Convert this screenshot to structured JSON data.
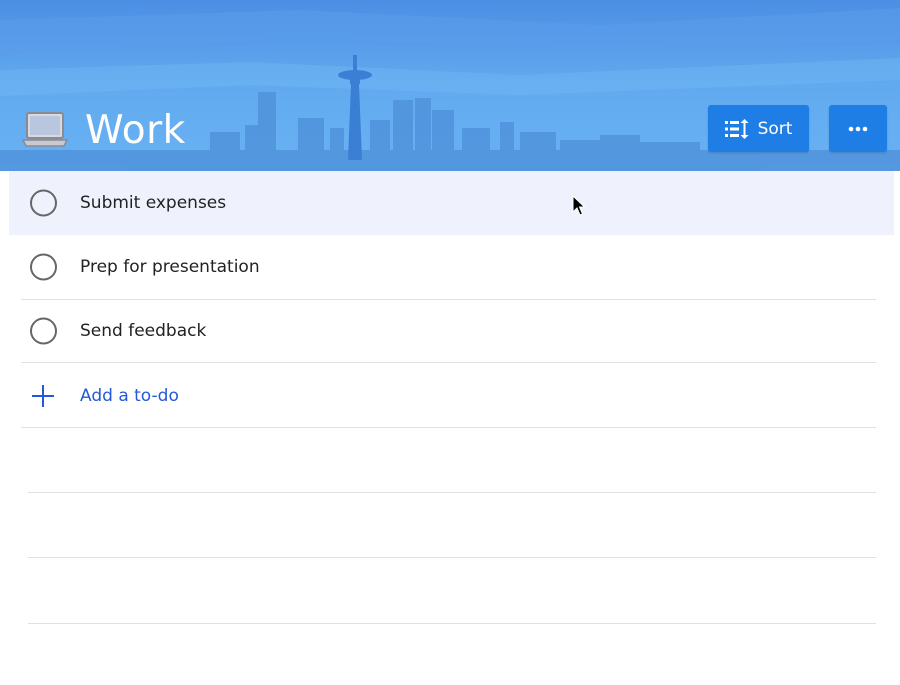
{
  "list": {
    "title": "Work",
    "icon": "laptop-icon"
  },
  "toolbar": {
    "sort_label": "Sort",
    "sort_icon": "sort-icon",
    "more_icon": "more-icon"
  },
  "tasks": [
    {
      "title": "Submit expenses",
      "completed": false,
      "hovered": true
    },
    {
      "title": "Prep for presentation",
      "completed": false,
      "hovered": false
    },
    {
      "title": "Send feedback",
      "completed": false,
      "hovered": false
    }
  ],
  "add_task": {
    "label": "Add a to-do",
    "icon": "plus-icon"
  },
  "colors": {
    "accent": "#1f7ee6",
    "header_bg": "#5ea5ee",
    "add_text": "#2458d8",
    "hover_row": "#eff2fd"
  }
}
